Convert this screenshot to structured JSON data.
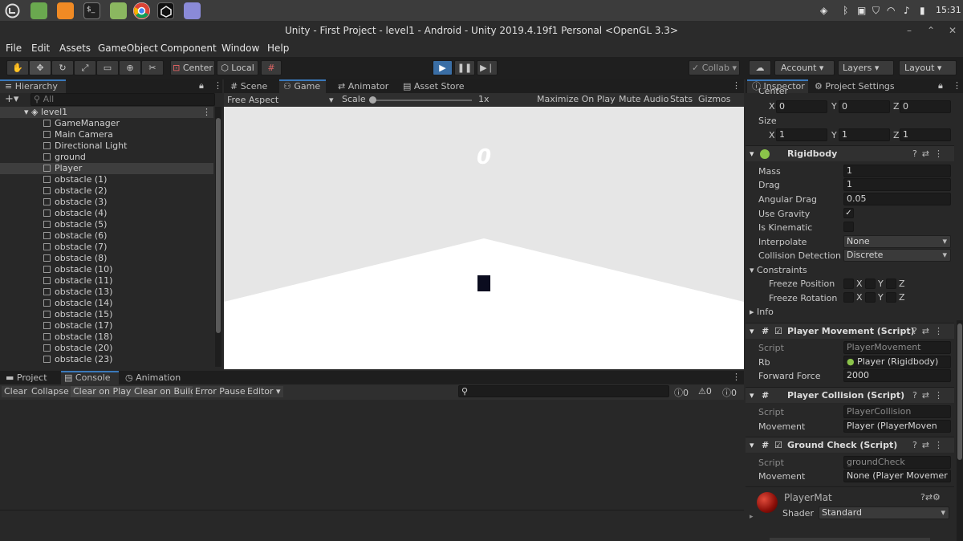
{
  "taskbar": {
    "apps": [
      "menu-icon",
      "files-icon",
      "firefox-icon",
      "terminal-icon",
      "folder-icon",
      "chrome-icon",
      "unity-icon",
      "text-editor-icon"
    ],
    "clock": "15:31"
  },
  "window": {
    "title": "Unity - First Project - level1 - Android - Unity 2019.4.19f1 Personal <OpenGL 3.3>"
  },
  "menu": [
    "File",
    "Edit",
    "Assets",
    "GameObject",
    "Component",
    "Window",
    "Help"
  ],
  "toolbar": {
    "pivot": "Center",
    "space": "Local",
    "collab": "Collab",
    "account": "Account",
    "layers": "Layers",
    "layout": "Layout"
  },
  "hierarchy": {
    "tab": "Hierarchy",
    "search_placeholder": "All",
    "scene": "level1",
    "items": [
      "GameManager",
      "Main Camera",
      "Directional Light",
      "ground",
      "Player",
      "obstacle (1)",
      "obstacle (2)",
      "obstacle (3)",
      "obstacle (4)",
      "obstacle (5)",
      "obstacle (6)",
      "obstacle (7)",
      "obstacle (8)",
      "obstacle (10)",
      "obstacle (11)",
      "obstacle (13)",
      "obstacle (14)",
      "obstacle (15)",
      "obstacle (17)",
      "obstacle (18)",
      "obstacle (20)",
      "obstacle (23)"
    ],
    "selected": "Player"
  },
  "game_view": {
    "tabs": [
      "Scene",
      "Game",
      "Animator",
      "Asset Store"
    ],
    "aspect": "Free Aspect",
    "scale_label": "Scale",
    "scale_value": "1x",
    "options": [
      "Maximize On Play",
      "Mute Audio",
      "Stats",
      "Gizmos"
    ],
    "score": "0"
  },
  "console": {
    "tabs": [
      "Project",
      "Console",
      "Animation"
    ],
    "buttons": [
      "Clear",
      "Collapse",
      "Clear on Play",
      "Clear on Build",
      "Error Pause",
      "Editor"
    ],
    "counts": [
      "0",
      "0",
      "0"
    ]
  },
  "inspector": {
    "tabs": [
      "Inspector",
      "Project Settings"
    ],
    "center_label": "Center",
    "center": {
      "x": "0",
      "y": "0",
      "z": "0"
    },
    "size_label": "Size",
    "size": {
      "x": "1",
      "y": "1",
      "z": "1"
    },
    "rigidbody": {
      "title": "Rigidbody",
      "mass_label": "Mass",
      "mass": "1",
      "drag_label": "Drag",
      "drag": "1",
      "angular_drag_label": "Angular Drag",
      "angular_drag": "0.05",
      "use_gravity_label": "Use Gravity",
      "is_kinematic_label": "Is Kinematic",
      "interpolate_label": "Interpolate",
      "interpolate": "None",
      "collision_label": "Collision Detection",
      "collision": "Discrete",
      "constraints_label": "Constraints",
      "freeze_position_label": "Freeze Position",
      "freeze_rotation_label": "Freeze Rotation",
      "info_label": "Info"
    },
    "player_movement": {
      "title": "Player Movement (Script)",
      "script_label": "Script",
      "script": "PlayerMovement",
      "rb_label": "Rb",
      "rb": "Player (Rigidbody)",
      "force_label": "Forward Force",
      "force": "2000"
    },
    "player_collision": {
      "title": "Player Collision (Script)",
      "script_label": "Script",
      "script": "PlayerCollision",
      "movement_label": "Movement",
      "movement": "Player (PlayerMoven"
    },
    "ground_check": {
      "title": "Ground Check (Script)",
      "script_label": "Script",
      "script": "groundCheck",
      "movement_label": "Movement",
      "movement": "None (Player Movemer"
    },
    "material": {
      "name": "PlayerMat",
      "shader_label": "Shader",
      "shader": "Standard"
    },
    "axes": {
      "x": "X",
      "y": "Y",
      "z": "Z"
    }
  }
}
